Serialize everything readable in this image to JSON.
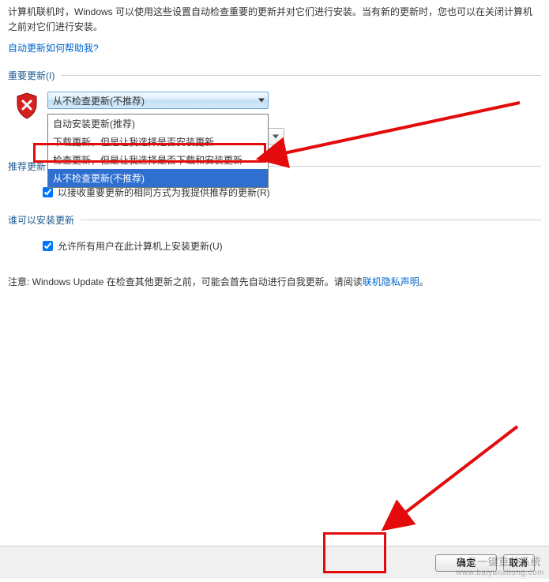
{
  "intro": {
    "line1": "计算机联机时，Windows 可以使用这些设置自动检查重要的更新并对它们进行安装。当有新的更新时，您也可以在关闭计算机之前对它们进行安装。",
    "help_link": "自动更新如何帮助我?"
  },
  "sections": {
    "important": {
      "legend": "重要更新(I)",
      "combo_selected": "从不检查更新(不推荐)",
      "options": [
        "自动安装更新(推荐)",
        "下载更新，但是让我选择是否安装更新",
        "检查更新，但是让我选择是否下载和安装更新",
        "从不检查更新(不推荐)"
      ]
    },
    "recommended": {
      "legend": "推荐更新",
      "checkbox_label": "以接收重要更新的相同方式为我提供推荐的更新(R)"
    },
    "who": {
      "legend": "谁可以安装更新",
      "checkbox_label": "允许所有用户在此计算机上安装更新(U)"
    }
  },
  "note": {
    "prefix": "注意: Windows Update 在检查其他更新之前，可能会首先自动进行自我更新。请阅读",
    "link": "联机隐私声明",
    "suffix": "。"
  },
  "buttons": {
    "ok": "确定",
    "cancel": "取消"
  },
  "watermark": {
    "title": "白云一键重装系统",
    "url": "www.baiyunxitong.com"
  }
}
